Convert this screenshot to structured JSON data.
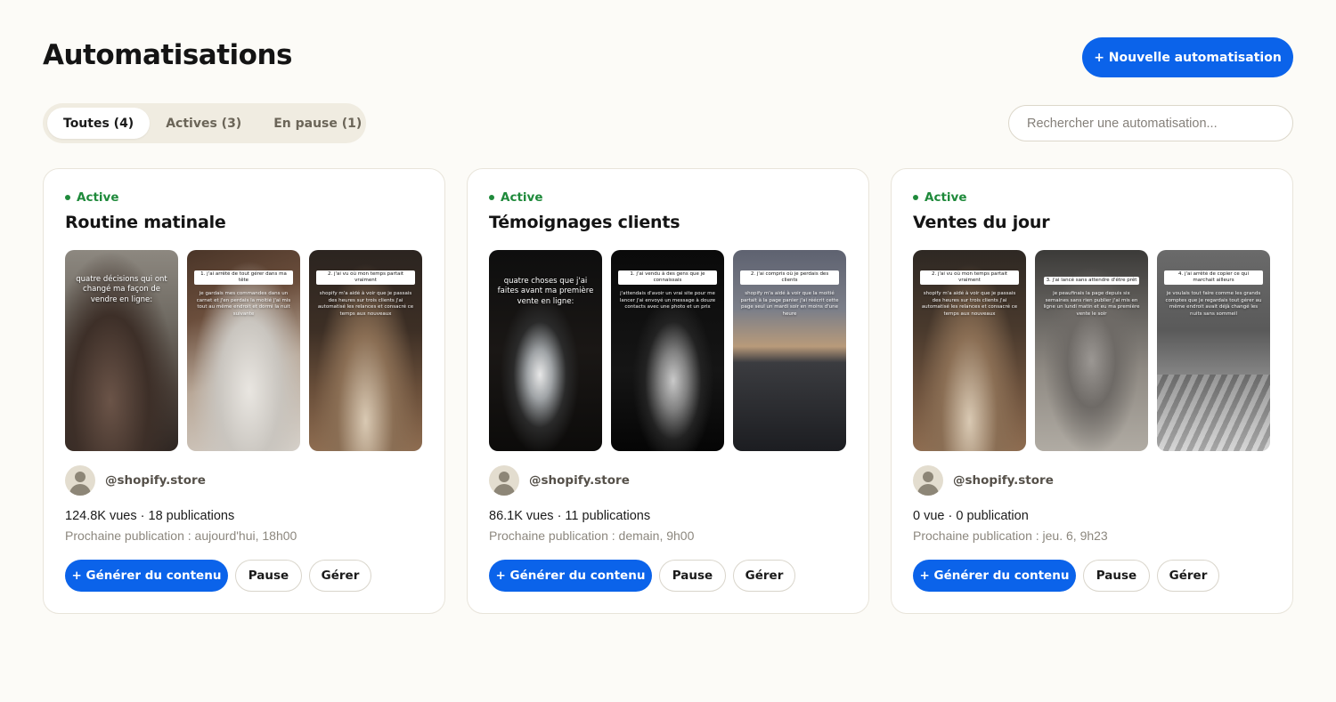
{
  "header": {
    "title": "Automatisations",
    "new_button": "+ Nouvelle automatisation"
  },
  "filters": {
    "tabs": [
      {
        "label": "Toutes (4)",
        "active": true
      },
      {
        "label": "Actives (3)",
        "active": false
      },
      {
        "label": "En pause (1)",
        "active": false
      }
    ]
  },
  "search": {
    "placeholder": "Rechercher une automatisation...",
    "value": ""
  },
  "colors": {
    "accent": "#0b63ea",
    "status_active": "#1f8a3b",
    "background": "#fcfbf7"
  },
  "cards": [
    {
      "status": "Active",
      "title": "Routine matinale",
      "thumbnails": [
        {
          "headline": "quatre décisions qui ont changé ma façon de vendre en ligne:",
          "tag": "",
          "body": ""
        },
        {
          "headline": "",
          "tag": "1. j'ai arrêté de tout gérer dans ma tête",
          "body": "je gardais mes commandes dans un carnet et j'en perdais la moitié  j'ai mis tout au même endroit et dormi la nuit suivante"
        },
        {
          "headline": "",
          "tag": "2. j'ai vu où mon temps partait vraiment",
          "body": "shopify m'a aidé à voir que je passais des heures sur trois clients  j'ai automatisé les relances et consacré ce temps aux nouveaux"
        }
      ],
      "author": "@shopify.store",
      "stats": "124.8K vues · 18 publications",
      "next": "Prochaine publication : aujourd'hui, 18h00",
      "generate_label": "+ Générer du contenu",
      "pause_label": "Pause",
      "manage_label": "Gérer"
    },
    {
      "status": "Active",
      "title": "Témoignages clients",
      "thumbnails": [
        {
          "headline": "quatre choses que j'ai faites avant ma première vente en ligne:",
          "tag": "",
          "body": ""
        },
        {
          "headline": "",
          "tag": "1. j'ai vendu à des gens que je connaissais",
          "body": "j'attendais d'avoir un vrai site pour me lancer  j'ai envoyé un message à douze contacts avec une photo et un prix"
        },
        {
          "headline": "",
          "tag": "2. j'ai compris où je perdais des clients",
          "body": "shopify m'a aidé à voir que la moitié partait à la page panier  j'ai réécrit cette page seul un mardi soir en moins d'une heure"
        }
      ],
      "author": "@shopify.store",
      "stats": "86.1K vues · 11 publications",
      "next": "Prochaine publication : demain, 9h00",
      "generate_label": "+ Générer du contenu",
      "pause_label": "Pause",
      "manage_label": "Gérer"
    },
    {
      "status": "Active",
      "title": "Ventes du jour",
      "thumbnails": [
        {
          "headline": "",
          "tag": "2. j'ai vu où mon temps partait vraiment",
          "body": "shopify m'a aidé à voir que je passais des heures sur trois clients  j'ai automatisé les relances et consacré ce temps aux nouveaux"
        },
        {
          "headline": "",
          "tag": "3. j'ai lancé sans attendre d'être prêt",
          "body": "je peaufinais la page depuis six semaines sans rien publier  j'ai mis en ligne un lundi matin et eu ma première vente le soir"
        },
        {
          "headline": "",
          "tag": "4. j'ai arrêté de copier ce qui marchait ailleurs",
          "body": "je voulais tout faire comme les grands comptes que je regardais  tout gérer au même endroit avait déjà changé les nuits sans sommeil"
        }
      ],
      "author": "@shopify.store",
      "stats": "0 vue · 0 publication",
      "next": "Prochaine publication : jeu. 6, 9h23",
      "generate_label": "+ Générer du contenu",
      "pause_label": "Pause",
      "manage_label": "Gérer"
    }
  ]
}
